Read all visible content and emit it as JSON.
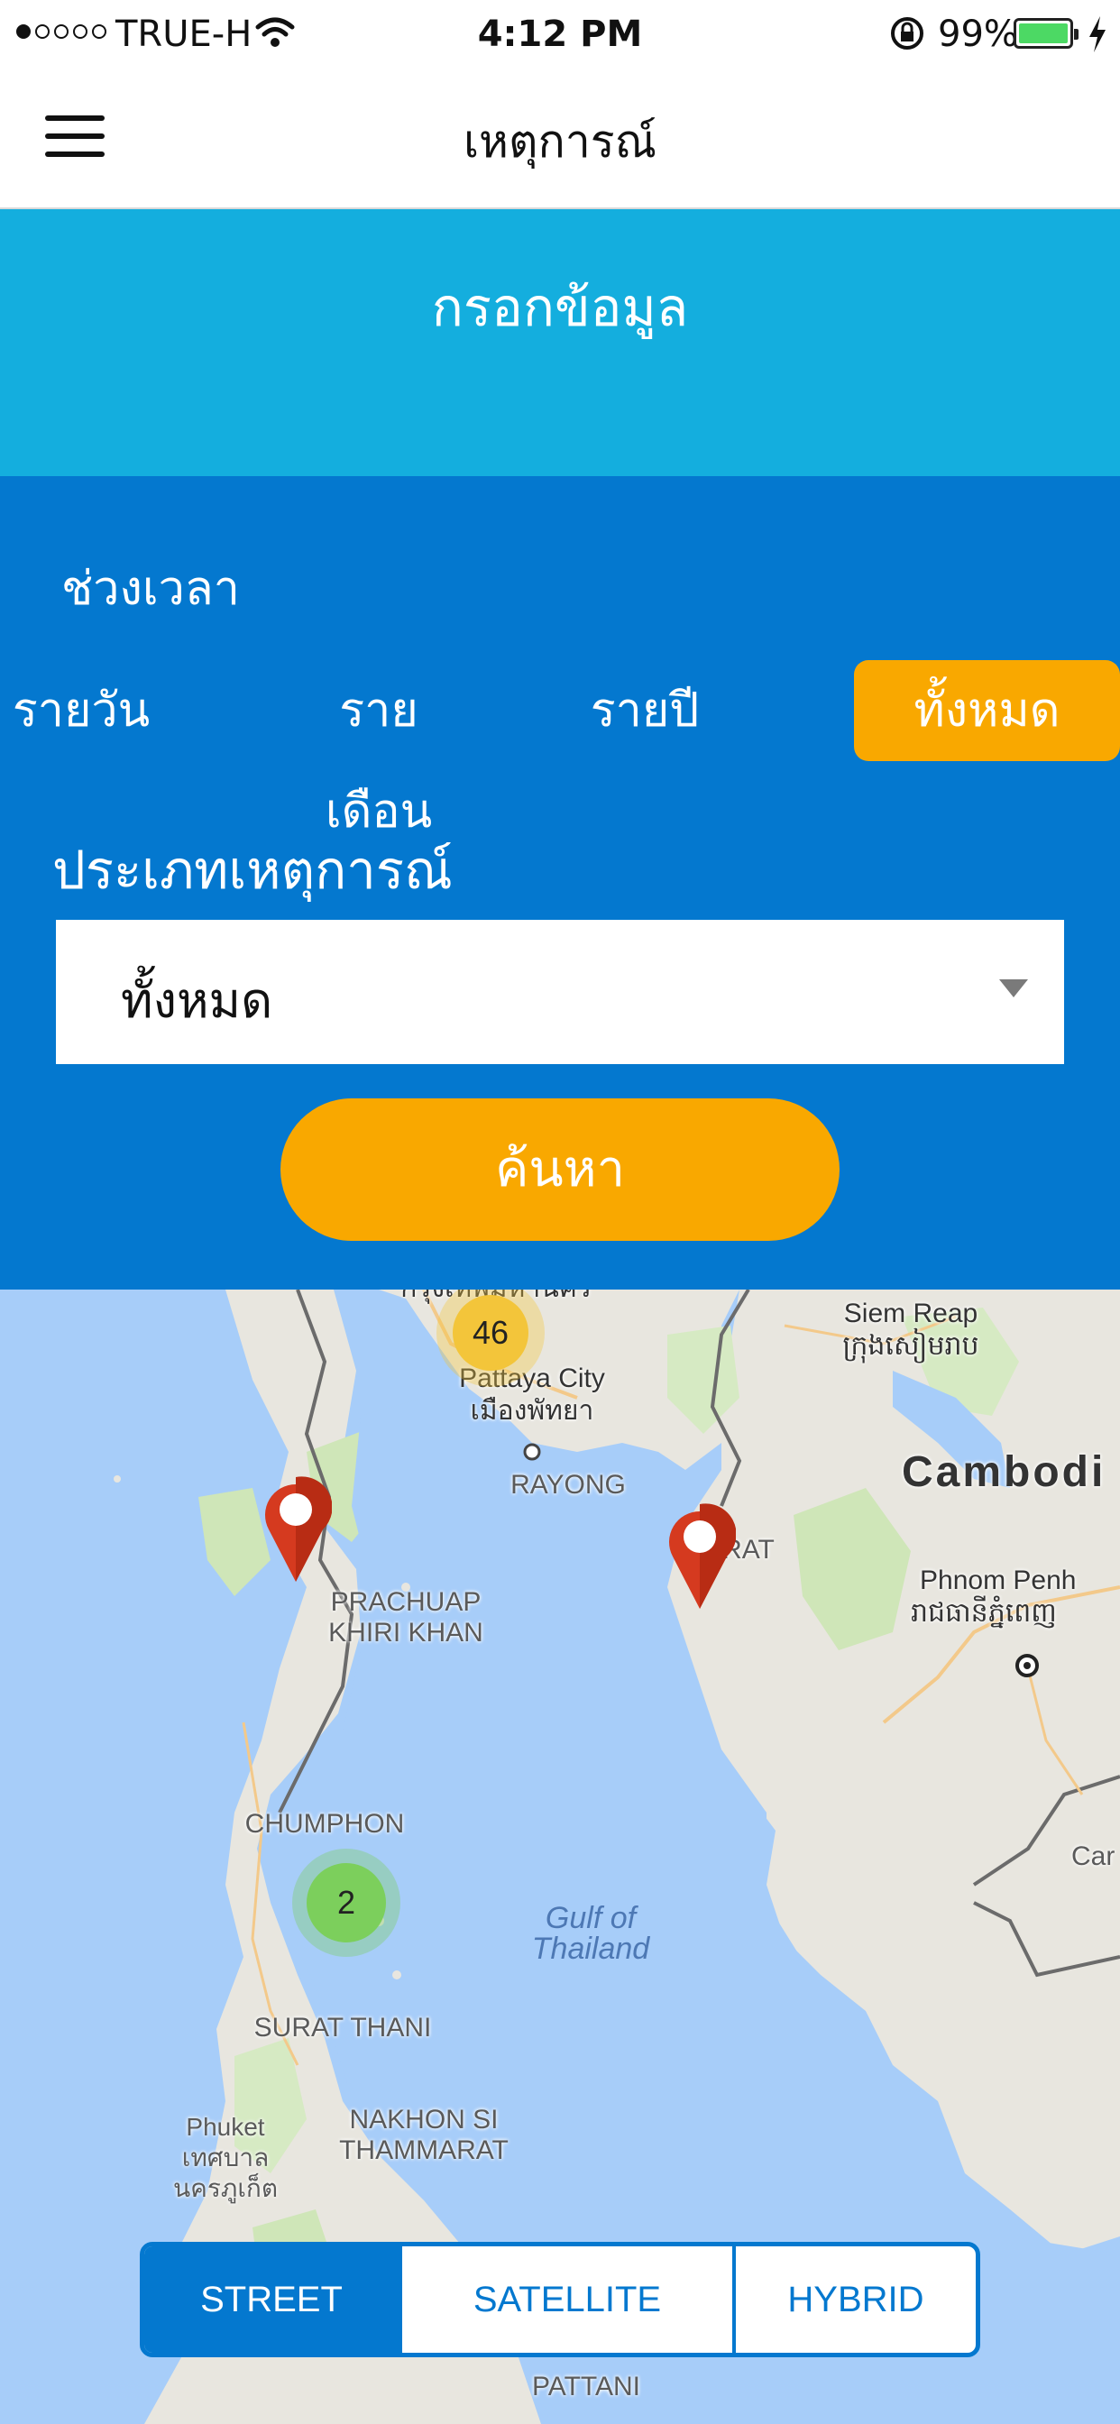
{
  "status_bar": {
    "carrier": "TRUE-H",
    "time": "4:12 PM",
    "battery": "99%",
    "signal_icon": "signal-dots-icon",
    "wifi_icon": "wifi-icon",
    "battery_color": "#4cd964"
  },
  "nav": {
    "title": "เหตุการณ์",
    "menu_icon": "hamburger-menu-icon"
  },
  "input_header": {
    "title": "กรอกข้อมูล",
    "expand_icon": "double-chevron-down-icon"
  },
  "filters": {
    "time_label": "ช่วงเวลา",
    "periods": [
      {
        "label": "รายวัน",
        "active": false
      },
      {
        "label": "รายเดือน",
        "active": false
      },
      {
        "label": "รายปี",
        "active": false
      },
      {
        "label": "ทั้งหมด",
        "active": true
      }
    ],
    "event_type_label": "ประเภทเหตุการณ์",
    "event_type_value": "ทั้งหมด",
    "search_label": "ค้นหา"
  },
  "map": {
    "labels": {
      "siem_reap": "Siem Reap",
      "siem_reap_khmer": "ក្រុងសៀមរាប",
      "pattaya": "Pattaya City",
      "pattaya_thai": "เมืองพัทยา",
      "rayong": "RAYONG",
      "cambodia": "Cambodi",
      "trat_partial": "RAT",
      "prachuap": "PRACHUAP\nKHIRI KHAN",
      "phnom_penh": "Phnom Penh",
      "phnom_penh_khmer": "រាជធានីភ្នំពេញ",
      "chumphon": "CHUMPHON",
      "gulf": "Gulf of\nThailand",
      "car_partial": "Car",
      "surat_thani": "SURAT THANI",
      "phuket": "Phuket\nเทศบาล\nนครภูเก็ต",
      "nakhon_si": "NAKHON SI\nTHAMMARAT",
      "pattani": "PATTANI",
      "bangkok_partial": "กรุงเทพมหานคร"
    },
    "clusters": [
      {
        "count": "46",
        "color": "#f3c53a"
      },
      {
        "count": "2",
        "color": "#7ccf5c"
      }
    ],
    "markers": [
      "map-pin-icon",
      "map-pin-icon"
    ],
    "marker_color": "#d53a1f",
    "types": [
      {
        "label": "STREET",
        "active": true
      },
      {
        "label": "SATELLITE",
        "active": false
      },
      {
        "label": "HYBRID",
        "active": false
      }
    ]
  },
  "colors": {
    "header_cyan": "#14aede",
    "panel_blue": "#0478cf",
    "accent_orange": "#f9a800",
    "map_water": "#a7cdf9"
  }
}
